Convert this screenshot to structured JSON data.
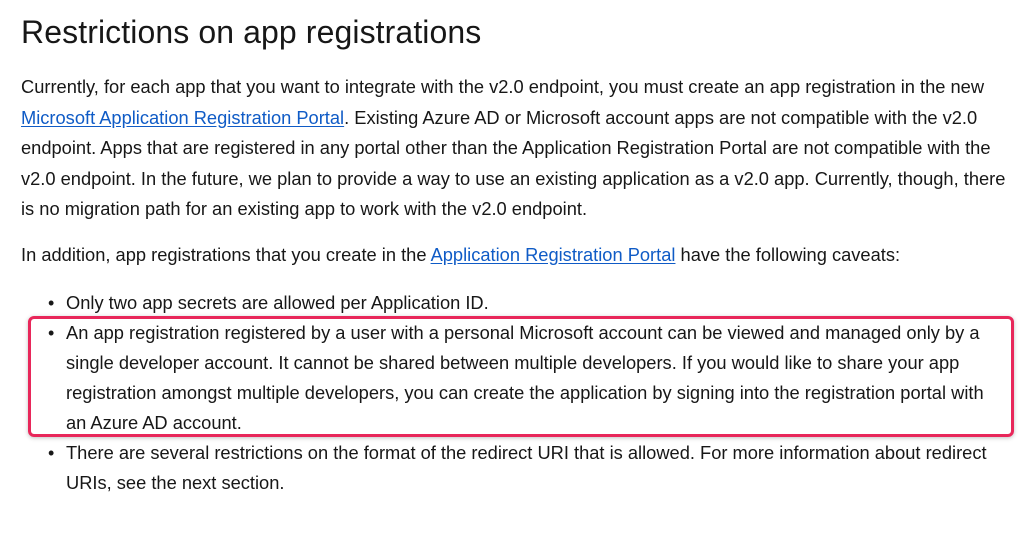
{
  "article": {
    "heading": "Restrictions on app registrations",
    "p1": {
      "text_a": "Currently, for each app that you want to integrate with the v2.0 endpoint, you must create an app registration in the new ",
      "link": "Microsoft Application Registration Portal",
      "text_b": ". Existing Azure AD or Microsoft account apps are not compatible with the v2.0 endpoint. Apps that are registered in any portal other than the Application Registration Portal are not compatible with the v2.0 endpoint. In the future, we plan to provide a way to use an existing application as a v2.0 app. Currently, though, there is no migration path for an existing app to work with the v2.0 endpoint."
    },
    "p2": {
      "text_a": "In addition, app registrations that you create in the ",
      "link": "Application Registration Portal",
      "text_b": " have the following caveats:"
    },
    "caveats": [
      "Only two app secrets are allowed per Application ID.",
      "An app registration registered by a user with a personal Microsoft account can be viewed and managed only by a single developer account. It cannot be shared between multiple developers. If you would like to share your app registration amongst multiple developers, you can create the application by signing into the registration portal with an Azure AD account.",
      "There are several restrictions on the format of the redirect URI that is allowed. For more information about redirect URIs, see the next section."
    ]
  },
  "colors": {
    "link": "#0f5bc6",
    "highlight_border": "#e8275a",
    "text": "#171717"
  }
}
